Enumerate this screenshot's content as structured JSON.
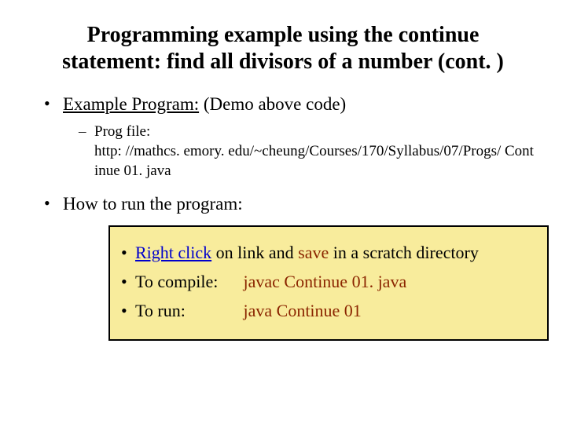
{
  "title": "Programming example using the continue statement: find all divisors of a number (cont. )",
  "bullets": {
    "example_label": "Example Program:",
    "example_paren": " (Demo above code)",
    "progfile_label": "Prog file:",
    "progfile_url": "http: //mathcs. emory. edu/~cheung/Courses/170/Syllabus/07/Progs/ Continue 01. java",
    "howto_label": "How to run the program:"
  },
  "box": {
    "line1_a": "Right click",
    "line1_b": " on link and ",
    "line1_c": "save",
    "line1_d": " in a scratch directory",
    "compile_label": "To compile:",
    "compile_cmd": "javac Continue 01. java",
    "run_label": "To run:",
    "run_cmd": "java Continue 01"
  }
}
